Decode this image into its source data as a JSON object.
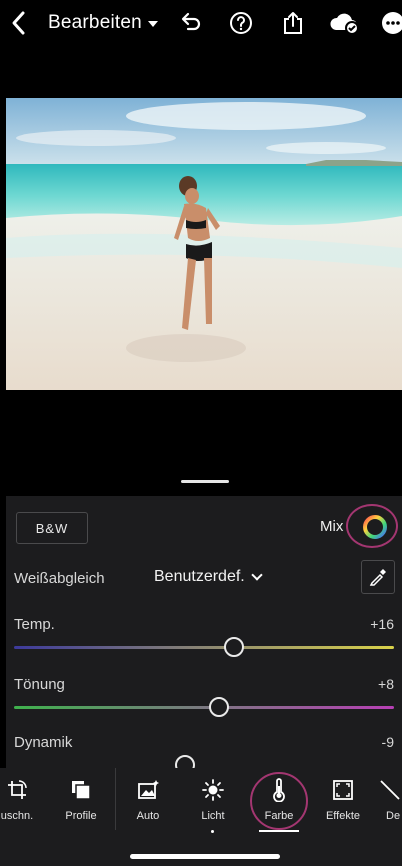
{
  "topbar": {
    "title": "Bearbeiten",
    "icons": [
      "chevron-left-icon",
      "caret-down-icon",
      "undo-icon",
      "help-icon",
      "share-icon",
      "cloud-sync-icon",
      "more-icon"
    ]
  },
  "panel": {
    "bw_label": "B&W",
    "mix_label": "Mix",
    "white_balance": {
      "label": "Weißabgleich",
      "value": "Benutzerdef."
    },
    "sliders": [
      {
        "label": "Temp.",
        "value": "+16",
        "fraction": 0.58,
        "gradient": [
          "#3d3a9c",
          "#d9d24a"
        ]
      },
      {
        "label": "Tönung",
        "value": "+8",
        "fraction": 0.54,
        "gradient": [
          "#3fb24d",
          "#b73fb5"
        ]
      },
      {
        "label": "Dynamik",
        "value": "-9",
        "fraction": 0.45
      }
    ],
    "accent_highlight": "#b23a7a"
  },
  "toolbar": {
    "items": [
      {
        "label": "uschn.",
        "icon": "crop-icon"
      },
      {
        "label": "Profile",
        "icon": "profiles-icon"
      },
      {
        "label": "Auto",
        "icon": "auto-icon"
      },
      {
        "label": "Licht",
        "icon": "light-icon"
      },
      {
        "label": "Farbe",
        "icon": "thermometer-icon",
        "active": true
      },
      {
        "label": "Effekte",
        "icon": "effects-icon"
      },
      {
        "label": "De",
        "icon": "detail-icon"
      }
    ]
  }
}
